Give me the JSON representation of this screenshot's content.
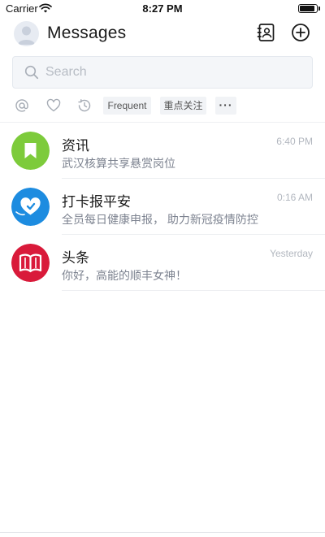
{
  "status_bar": {
    "carrier": "Carrier",
    "time": "8:27 PM",
    "battery_level": 0.95
  },
  "header": {
    "title": "Messages",
    "avatar_icon": "user-avatar-icon",
    "contacts_icon": "contacts-book-icon",
    "add_icon": "plus-circle-icon"
  },
  "search": {
    "placeholder": "Search",
    "value": ""
  },
  "filters": {
    "icons": [
      "at-mention-icon",
      "heart-icon",
      "history-icon"
    ],
    "frequent_label": "Frequent",
    "focus_label": "重点关注",
    "more_label": "···"
  },
  "messages": [
    {
      "title": "资讯",
      "preview": "武汉核算共享悬赏岗位",
      "time": "6:40 PM",
      "icon": "bookmark-icon",
      "color": "#7dcb3b"
    },
    {
      "title": "打卡报平安",
      "preview": "全员每日健康申报， 助力新冠疫情防控",
      "time": "0:16 AM",
      "icon": "heart-check-icon",
      "color": "#1d8ce0"
    },
    {
      "title": "头条",
      "preview": "你好，高能的顺丰女神！",
      "time": "Yesterday",
      "icon": "open-book-icon",
      "color": "#d91a3a"
    }
  ],
  "colors": {
    "accent": "#1d8ce0",
    "text_primary": "#1a1a1a",
    "text_secondary": "#7d8390",
    "timestamp": "#b2b7bf"
  }
}
